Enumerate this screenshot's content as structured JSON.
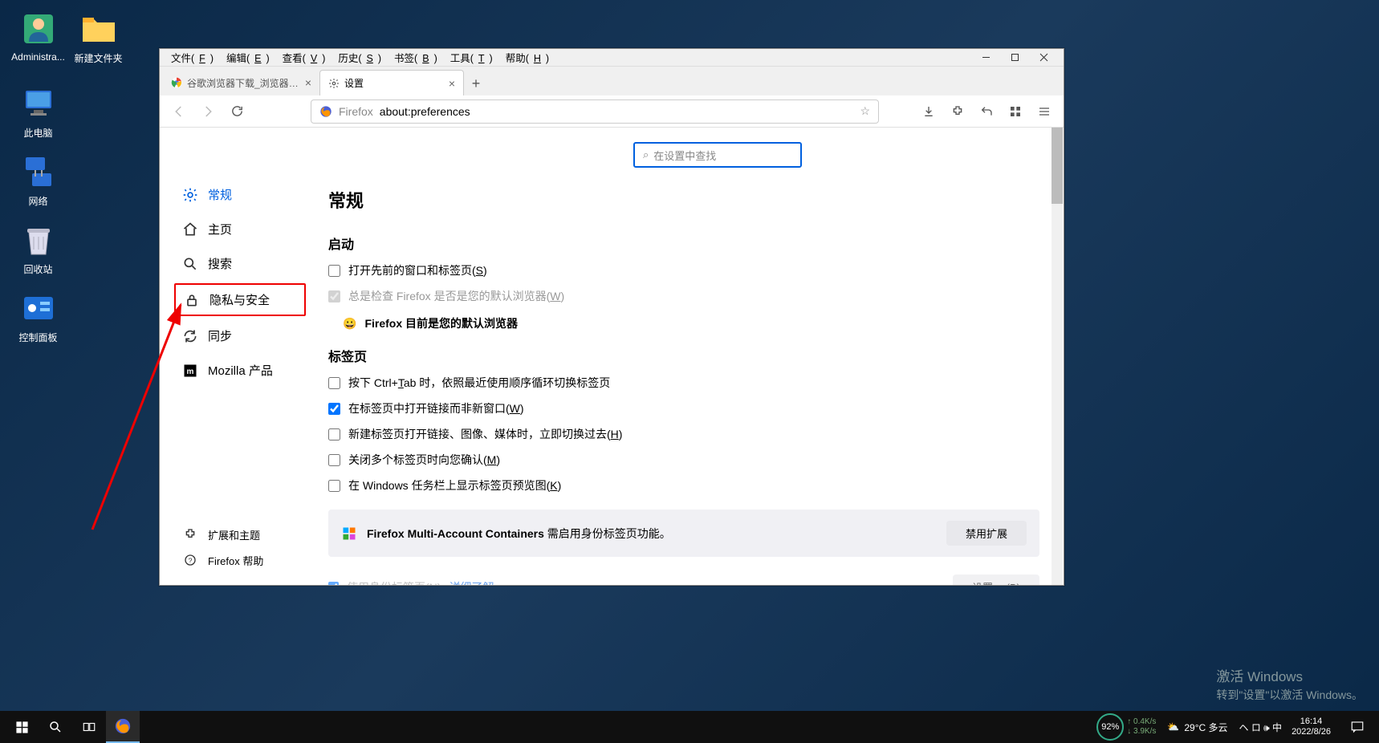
{
  "desktop": {
    "icons": {
      "admin": "Administra...",
      "folder": "新建文件夹",
      "pc": "此电脑",
      "net": "网络",
      "trash": "回收站",
      "ctrl": "控制面板"
    }
  },
  "firefox": {
    "menubar": [
      "文件(F)",
      "编辑(E)",
      "查看(V)",
      "历史(S)",
      "书签(B)",
      "工具(T)",
      "帮助(H)"
    ],
    "tabs": {
      "t0": {
        "title": "谷歌浏览器下载_浏览器官网入口",
        "icon": "chrome"
      },
      "t1": {
        "title": "设置",
        "icon": "gear"
      }
    },
    "urlbar": {
      "prefix": "Firefox",
      "url": "about:preferences"
    },
    "search_placeholder": "在设置中查找",
    "sidebar": {
      "general": "常规",
      "home": "主页",
      "search": "搜索",
      "privacy": "隐私与安全",
      "sync": "同步",
      "mozilla": "Mozilla 产品",
      "extensions": "扩展和主题",
      "help": "Firefox 帮助"
    },
    "main": {
      "h1": "常规",
      "startup": {
        "heading": "启动",
        "restore": "打开先前的窗口和标签页(S)",
        "always_check": "总是检查 Firefox 是否是您的默认浏览器(W)",
        "default_msg": "Firefox 目前是您的默认浏览器"
      },
      "tabs": {
        "heading": "标签页",
        "ctrltab": "按下 Ctrl+Tab 时，依照最近使用顺序循环切换标签页",
        "open_links": "在标签页中打开链接而非新窗口(W)",
        "switch_new": "新建标签页打开链接、图像、媒体时，立即切换过去(H)",
        "close_multi": "关闭多个标签页时向您确认(M)",
        "taskbar_preview": "在 Windows 任务栏上显示标签页预览图(K)"
      },
      "ext": {
        "text_strong": "Firefox Multi-Account Containers",
        "text_rest": " 需启用身份标签页功能。",
        "btn": "禁用扩展"
      },
      "truncated_link": "详细了解",
      "truncated_pre": "使用身份标签页(N)",
      "truncated_btn": "设置…   (B)"
    }
  },
  "watermark": {
    "l1": "激活 Windows",
    "l2": "转到\"设置\"以激活 Windows。"
  },
  "taskbar": {
    "gauge": "92%",
    "net_up": "0.4K/s",
    "net_down": "3.9K/s",
    "weather": "29°C 多云",
    "tray": "ヘ ロ 🕪 中",
    "time": "16:14",
    "date": "2022/8/26"
  }
}
